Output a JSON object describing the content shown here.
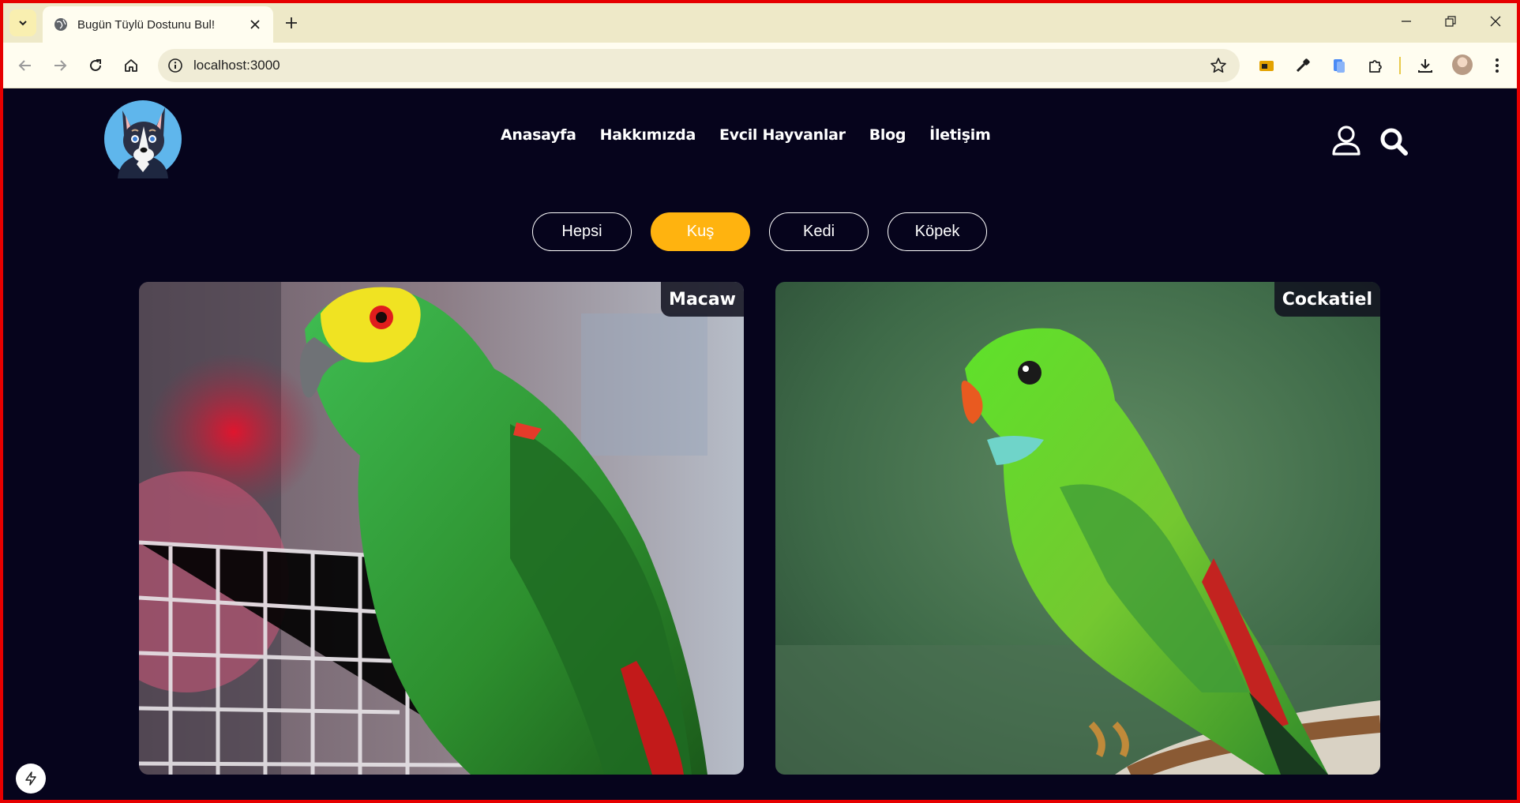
{
  "browser": {
    "tab_title": "Bugün Tüylü Dostunu Bul!",
    "url": "localhost:3000"
  },
  "site": {
    "nav": [
      "Anasayfa",
      "Hakkımızda",
      "Evcil Hayvanlar",
      "Blog",
      "İletişim"
    ],
    "filters": [
      {
        "label": "Hepsi",
        "active": false
      },
      {
        "label": "Kuş",
        "active": true
      },
      {
        "label": "Kedi",
        "active": false
      },
      {
        "label": "Köpek",
        "active": false
      }
    ],
    "accent_color": "#ffb30f",
    "background_color": "#06041c",
    "pets": [
      {
        "name": "Macaw"
      },
      {
        "name": "Cockatiel"
      }
    ]
  }
}
